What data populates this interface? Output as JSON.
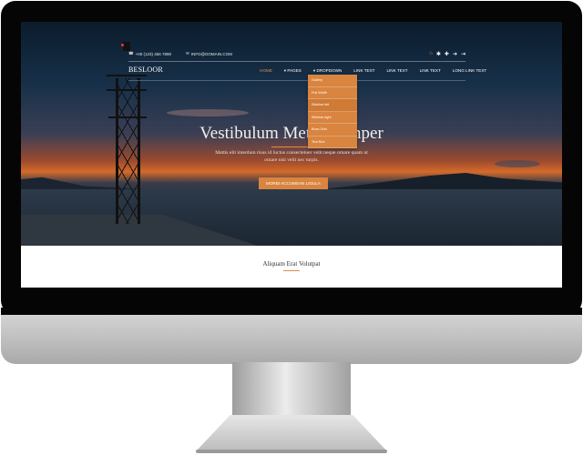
{
  "topbar": {
    "phone": "+00 (123) 456 7890",
    "email": "INFO@DOMAIN.COM",
    "icons": [
      "home-icon",
      "gear-icon",
      "plus-icon",
      "log-in-icon",
      "log-out-icon"
    ]
  },
  "nav": {
    "logo": "BESLOOR",
    "items": [
      "HOME",
      "PAGES",
      "DROPDOWN",
      "LINK TEXT",
      "LINK TEXT",
      "LINK TEXT",
      "LONG LINK TEXT"
    ],
    "dropdown": [
      "Gallery",
      "Full Width",
      "Sidebar left",
      "Sidebar right",
      "Boxs Grid",
      "Text Box"
    ]
  },
  "hero": {
    "title": "Vestibulum Metus Semper",
    "subtitle": "Mattis elit interdum risus id luctus consectetuer velit neque ornare quam ut ornare nisi velit nec turpis.",
    "button": "MORBI ACCUMSAN LIGULA"
  },
  "section": {
    "title": "Aliquam Erat Volutpat"
  },
  "colors": {
    "accent": "#d9843f",
    "bezel": "#050505"
  }
}
